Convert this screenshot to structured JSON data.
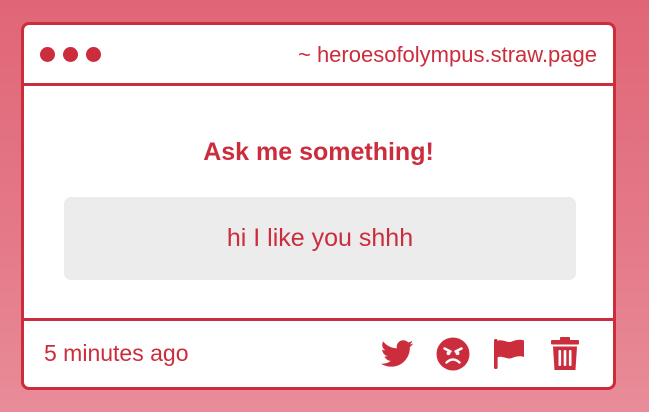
{
  "window": {
    "url": "~ heroesofolympus.straw.page"
  },
  "question": {
    "prompt": "Ask me something!",
    "message": "hi I like you shhh"
  },
  "footer": {
    "timestamp": "5 minutes ago",
    "actions": [
      {
        "icon": "twitter-icon"
      },
      {
        "icon": "angry-face-icon"
      },
      {
        "icon": "flag-icon"
      },
      {
        "icon": "trash-icon"
      }
    ]
  },
  "colors": {
    "accent": "#cc2d3c",
    "background_top": "#e06676",
    "background_bottom": "#e98c99",
    "answer_box": "#ececed",
    "card": "#ffffff"
  }
}
